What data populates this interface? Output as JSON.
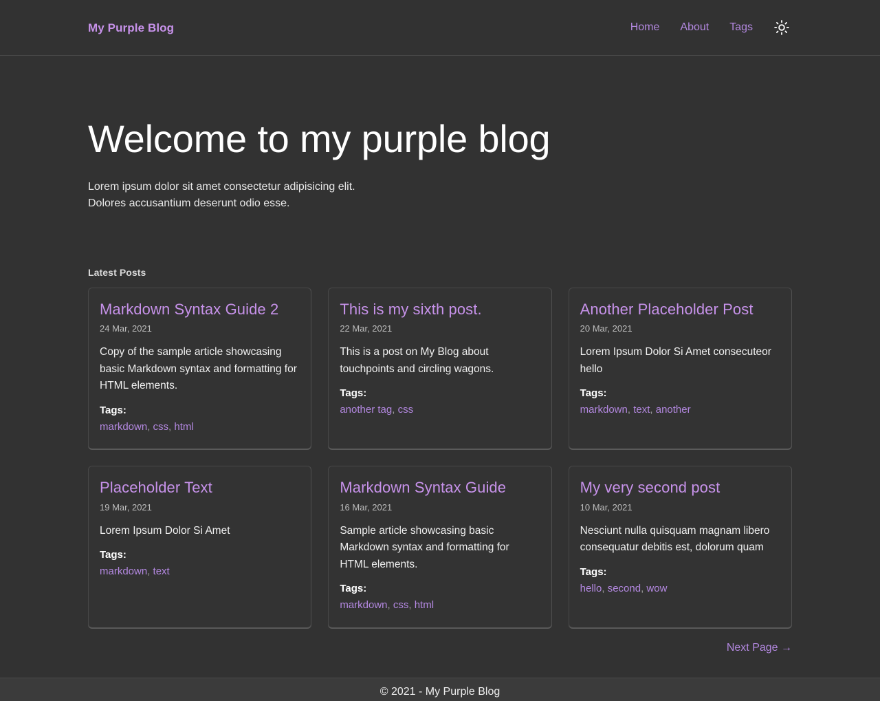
{
  "header": {
    "brand": "My Purple Blog",
    "nav": [
      {
        "label": "Home",
        "name": "nav-link-home"
      },
      {
        "label": "About",
        "name": "nav-link-about"
      },
      {
        "label": "Tags",
        "name": "nav-link-tags"
      }
    ],
    "theme_toggle_icon": "sun-icon"
  },
  "hero": {
    "title": "Welcome to my purple blog",
    "subtitle_line1": "Lorem ipsum dolor sit amet consectetur adipisicing elit.",
    "subtitle_line2": "Dolores accusantium deserunt odio esse."
  },
  "main": {
    "section_label": "Latest Posts",
    "tags_label": "Tags:",
    "tag_separator": ", ",
    "posts": [
      {
        "title": "Markdown Syntax Guide 2",
        "date": "24 Mar, 2021",
        "excerpt": "Copy of the sample article showcasing basic Markdown syntax and formatting for HTML elements.",
        "tags": [
          "markdown",
          "css",
          "html"
        ]
      },
      {
        "title": "This is my sixth post.",
        "date": "22 Mar, 2021",
        "excerpt": "This is a post on My Blog about touchpoints and circling wagons.",
        "tags": [
          "another tag",
          "css"
        ]
      },
      {
        "title": "Another Placeholder Post",
        "date": "20 Mar, 2021",
        "excerpt": "Lorem Ipsum Dolor Si Amet consecuteor hello",
        "tags": [
          "markdown",
          "text",
          "another"
        ]
      },
      {
        "title": "Placeholder Text",
        "date": "19 Mar, 2021",
        "excerpt": "Lorem Ipsum Dolor Si Amet",
        "tags": [
          "markdown",
          "text"
        ]
      },
      {
        "title": "Markdown Syntax Guide",
        "date": "16 Mar, 2021",
        "excerpt": "Sample article showcasing basic Markdown syntax and formatting for HTML elements.",
        "tags": [
          "markdown",
          "css",
          "html"
        ]
      },
      {
        "title": "My very second post",
        "date": "10 Mar, 2021",
        "excerpt": "Nesciunt nulla quisquam magnam libero consequatur debitis est, dolorum quam",
        "tags": [
          "hello",
          "second",
          "wow"
        ]
      }
    ]
  },
  "pagination": {
    "next_label": "Next Page →"
  },
  "footer": {
    "copyright": "© 2021 - My Purple Blog"
  },
  "colors": {
    "page_background": "#323232",
    "footer_background": "#3b3b3b",
    "card_background": "#333333",
    "card_border": "#484848",
    "accent_purple": "#c792ea",
    "link_purple": "#b388e0",
    "text_primary": "#f1f1f1",
    "text_muted": "#bdbdbd"
  }
}
